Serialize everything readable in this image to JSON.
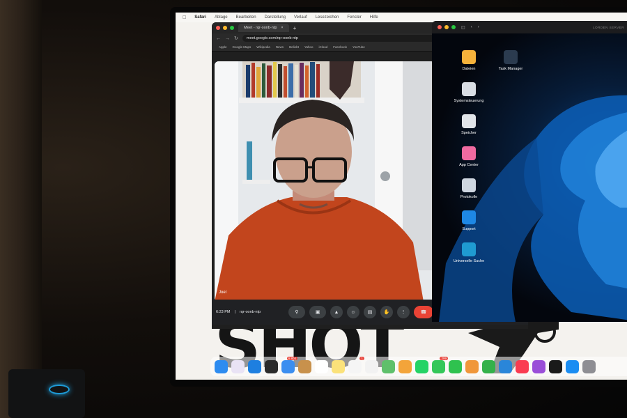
{
  "mac_menubar": {
    "app_name": "Safari",
    "menus": [
      "Ablage",
      "Bearbeiten",
      "Darstellung",
      "Verlauf",
      "Lesezeichen",
      "Fenster",
      "Hilfe"
    ]
  },
  "browser": {
    "tab_title": "Meet - rqr-oonb-ntp",
    "tab_close": "×",
    "new_tab": "+",
    "url": "meet.google.com/rqr-oonb-ntp",
    "bookmarks": [
      "Apple",
      "Google Maps",
      "Wikipedia",
      "News",
      "Beliebt",
      "Yahoo",
      "iCloud",
      "Facebook",
      "YouTube"
    ],
    "traffic_colors": [
      "#ff5f57",
      "#febc2e",
      "#28c840"
    ]
  },
  "meet": {
    "participant_name": "Joel",
    "time": "6:23 PM",
    "separator": "|",
    "meeting_code": "rqr-oonb-ntp",
    "controls": [
      "mic-icon",
      "camera-icon",
      "present-icon",
      "emoji-icon",
      "captions-icon",
      "hand-icon",
      "more-icon",
      "hangup-icon"
    ],
    "end_call_color": "#ea4335"
  },
  "remote_desktop": {
    "title": "LORDEN SERVER",
    "icons": [
      {
        "label": "Dateien",
        "icon": "folder-icon",
        "color": "#f6b23b"
      },
      {
        "label": "Task Manager",
        "icon": "task-manager-icon",
        "color": "#2b3b4f"
      },
      {
        "label": "Systemsteuerung",
        "icon": "settings-icon",
        "color": "#d9dde3"
      },
      {
        "label": "Speicher",
        "icon": "storage-icon",
        "color": "#e1e4e8"
      },
      {
        "label": "App Center",
        "icon": "app-center-icon",
        "color": "#f06aa0"
      },
      {
        "label": "Protokolle",
        "icon": "logs-icon",
        "color": "#cfd6e0"
      },
      {
        "label": "Support",
        "icon": "support-icon",
        "color": "#1e88e5"
      },
      {
        "label": "Universelle Suche",
        "icon": "search-icon",
        "color": "#1f9bd1"
      }
    ]
  },
  "poster": {
    "text": "SHOT"
  },
  "dock": {
    "items": [
      {
        "name": "finder-icon",
        "color": "#2d8cf0",
        "badge": ""
      },
      {
        "name": "launchpad-icon",
        "color": "#e9e3f5",
        "badge": ""
      },
      {
        "name": "safari-icon",
        "color": "#1e7fe0",
        "badge": ""
      },
      {
        "name": "chess-icon",
        "color": "#2b2b2b",
        "badge": ""
      },
      {
        "name": "mail-icon",
        "color": "#3b8ef0",
        "badge": "6.804"
      },
      {
        "name": "finder-alt-icon",
        "color": "#c8914c",
        "badge": ""
      },
      {
        "name": "calendar-icon",
        "color": "#ffffff",
        "badge": ""
      },
      {
        "name": "notes-icon",
        "color": "#fbe27a",
        "badge": ""
      },
      {
        "name": "reminders-icon",
        "color": "#f5f5f5",
        "badge": "1"
      },
      {
        "name": "freeform-icon",
        "color": "#f2f2f2",
        "badge": ""
      },
      {
        "name": "maps-icon",
        "color": "#5fc06b",
        "badge": ""
      },
      {
        "name": "photos-icon",
        "color": "#f3a43a",
        "badge": ""
      },
      {
        "name": "whatsapp-icon",
        "color": "#25d366",
        "badge": ""
      },
      {
        "name": "messages-icon",
        "color": "#34c759",
        "badge": "299"
      },
      {
        "name": "facetime-icon",
        "color": "#2fc24f",
        "badge": ""
      },
      {
        "name": "pages-icon",
        "color": "#f0973a",
        "badge": ""
      },
      {
        "name": "numbers-icon",
        "color": "#34b14a",
        "badge": ""
      },
      {
        "name": "keynote-icon",
        "color": "#2a86d9",
        "badge": ""
      },
      {
        "name": "music-icon",
        "color": "#fa3c51",
        "badge": ""
      },
      {
        "name": "podcasts-icon",
        "color": "#9a4ed8",
        "badge": ""
      },
      {
        "name": "tv-icon",
        "color": "#1a1a1a",
        "badge": ""
      },
      {
        "name": "app-store-icon",
        "color": "#1b8df2",
        "badge": ""
      },
      {
        "name": "system-settings-icon",
        "color": "#8e8e93",
        "badge": ""
      }
    ]
  }
}
